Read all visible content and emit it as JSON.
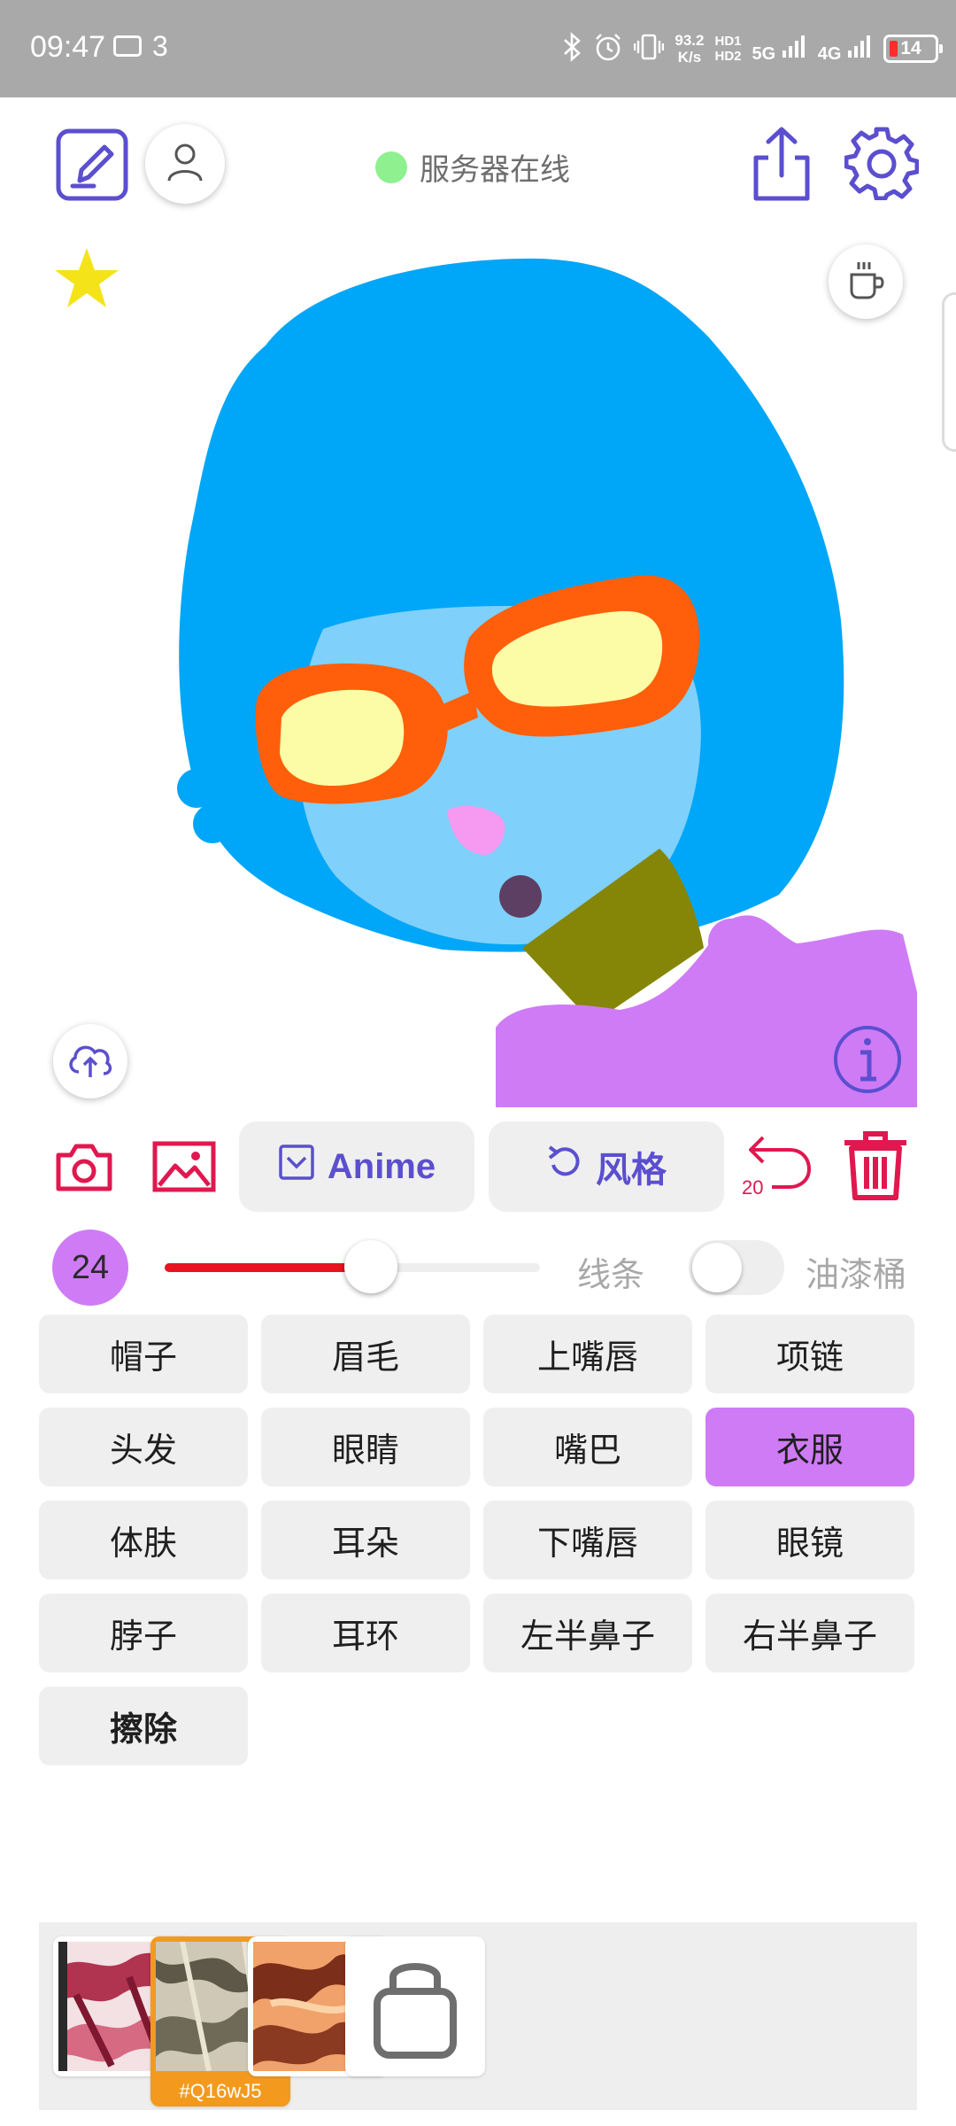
{
  "status_bar": {
    "time": "09:47",
    "message_count": "3",
    "speed_value": "93.2",
    "speed_unit": "K/s",
    "hd1": "HD1",
    "hd2": "HD2",
    "network1": "5G",
    "network2": "4G",
    "battery": "14"
  },
  "header": {
    "server_status": "服务器在线",
    "server_status_color": "#8ef08e",
    "accent_color": "#5b4fcf"
  },
  "toolbar": {
    "model_label": "Anime",
    "style_label": "风格",
    "undo_count": "20",
    "danger_color": "#e0184f"
  },
  "brush": {
    "size": "24",
    "slider_level": 0.55,
    "slider_color": "#e8141e",
    "line_label": "线条",
    "bucket_label": "油漆桶",
    "bucket_enabled": false
  },
  "parts": [
    {
      "label": "帽子",
      "active": false
    },
    {
      "label": "眉毛",
      "active": false
    },
    {
      "label": "上嘴唇",
      "active": false
    },
    {
      "label": "项链",
      "active": false
    },
    {
      "label": "头发",
      "active": false
    },
    {
      "label": "眼睛",
      "active": false
    },
    {
      "label": "嘴巴",
      "active": false
    },
    {
      "label": "衣服",
      "active": true
    },
    {
      "label": "体肤",
      "active": false
    },
    {
      "label": "耳朵",
      "active": false
    },
    {
      "label": "下嘴唇",
      "active": false
    },
    {
      "label": "眼镜",
      "active": false
    },
    {
      "label": "脖子",
      "active": false
    },
    {
      "label": "耳环",
      "active": false
    },
    {
      "label": "左半鼻子",
      "active": false
    },
    {
      "label": "右半鼻子",
      "active": false
    },
    {
      "label": "擦除",
      "active": false,
      "bold": true
    }
  ],
  "results": {
    "selected_caption": "#Q16wJ5"
  },
  "icons": [
    "edit-icon",
    "user-icon",
    "share-icon",
    "settings-icon",
    "star-icon",
    "coffee-icon",
    "upload-cloud-icon",
    "info-icon",
    "camera-icon",
    "image-icon",
    "undo-icon",
    "trash-icon",
    "bag-icon"
  ]
}
